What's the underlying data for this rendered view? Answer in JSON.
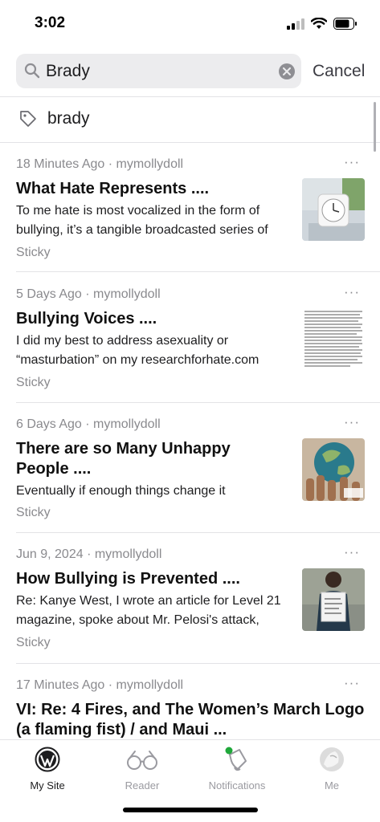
{
  "status_bar": {
    "time": "3:02"
  },
  "search": {
    "query": "Brady",
    "cancel_label": "Cancel"
  },
  "suggestion": {
    "tag": "brady"
  },
  "posts": [
    {
      "meta": "18 Minutes Ago · mymollydoll",
      "title_lines": [
        "What Hate Represents ...."
      ],
      "excerpt_lines": [
        "To me hate is most vocalized in the form of",
        "bullying, it’s a tangible broadcasted series of"
      ],
      "status": "Sticky",
      "more": "···"
    },
    {
      "meta": "5 Days Ago · mymollydoll",
      "title_lines": [
        "Bullying Voices ...."
      ],
      "excerpt_lines": [
        "I did my best to address asexuality or",
        "“masturbation” on my researchforhate.com"
      ],
      "status": "Sticky",
      "more": "···"
    },
    {
      "meta": "6 Days Ago · mymollydoll",
      "title_lines": [
        "There are so Many Unhappy",
        "People ...."
      ],
      "excerpt_lines": [
        "Eventually if enough things change it"
      ],
      "status": "Sticky",
      "more": "···"
    },
    {
      "meta": "Jun 9, 2024 · mymollydoll",
      "title_lines": [
        "How Bullying is Prevented ...."
      ],
      "excerpt_lines": [
        "Re: Kanye West, I wrote an article for Level 21",
        "magazine, spoke about Mr. Pelosi's attack,"
      ],
      "status": "Sticky",
      "more": "···"
    },
    {
      "meta": "17 Minutes Ago · mymollydoll",
      "title_lines": [
        "VI: Re: 4 Fires, and The Women’s March Logo",
        "(a flaming fist) / and Maui ..."
      ],
      "excerpt_lines": [],
      "status": "",
      "more": "···"
    }
  ],
  "tabs": [
    {
      "label": "My Site",
      "icon": "wordpress-icon",
      "active": true
    },
    {
      "label": "Reader",
      "icon": "glasses-icon",
      "active": false
    },
    {
      "label": "Notifications",
      "icon": "bell-icon",
      "active": false
    },
    {
      "label": "Me",
      "icon": "avatar",
      "active": false
    }
  ],
  "colors": {
    "accent": "#1d1d1f",
    "notification_dot": "#1fa83a",
    "muted": "#8a8a8e"
  }
}
